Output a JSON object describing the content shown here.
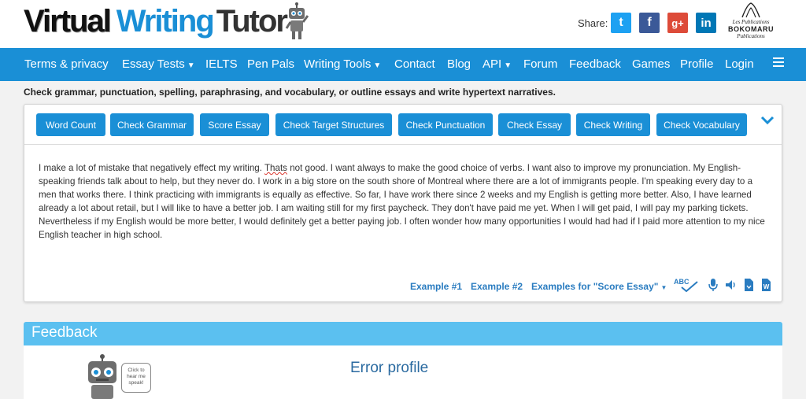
{
  "header": {
    "logo": {
      "part1": "Virtual",
      "part2": "Writing",
      "part3": "Tutor"
    },
    "share_label": "Share:",
    "social": [
      {
        "name": "twitter",
        "glyph": "t",
        "color": "#1da1f2"
      },
      {
        "name": "facebook",
        "glyph": "f",
        "color": "#3b5998"
      },
      {
        "name": "google-plus",
        "glyph": "g+",
        "color": "#dd4b39"
      },
      {
        "name": "linkedin",
        "glyph": "in",
        "color": "#0077b5"
      }
    ],
    "publisher": {
      "line1": "Les Publications",
      "line2": "BOKOMARU",
      "line3": "Publications"
    }
  },
  "nav": {
    "items": [
      {
        "label": "Terms & privacy",
        "dropdown": false
      },
      {
        "label": "Essay Tests",
        "dropdown": true
      },
      {
        "label": "IELTS",
        "dropdown": false
      },
      {
        "label": "Pen Pals",
        "dropdown": false
      },
      {
        "label": "Writing Tools",
        "dropdown": true
      },
      {
        "label": "Contact",
        "dropdown": false
      },
      {
        "label": "Blog",
        "dropdown": false
      },
      {
        "label": "API",
        "dropdown": true
      },
      {
        "label": "Forum",
        "dropdown": false
      },
      {
        "label": "Feedback",
        "dropdown": false
      },
      {
        "label": "Games",
        "dropdown": false
      },
      {
        "label": "Profile",
        "dropdown": false
      },
      {
        "label": "Login",
        "dropdown": false
      }
    ],
    "menu_icon": "hamburger-icon"
  },
  "tagline": "Check grammar, punctuation, spelling, paraphrasing, and vocabulary, or outline essays and write hypertext narratives.",
  "toolbar": {
    "buttons": [
      "Word Count",
      "Check Grammar",
      "Score Essay",
      "Check Target Structures",
      "Check Punctuation",
      "Check Essay",
      "Check Writing",
      "Check Vocabulary"
    ],
    "expand_icon": "chevron-down-icon"
  },
  "essay": {
    "before": "I make a lot of mistake that negatively effect my writing. ",
    "flagged": "Thats",
    "after": " not good. I want always to make the good choice of verbs. I want also to improve my pronunciation. My English-speaking friends talk about to help, but they never do. I work in a big store on the south shore of Montreal where there are a lot of immigrants people. I'm speaking every day to a men that works there. I think practicing with immigrants is equally as effective. So far, I have work there since 2 weeks and my English is getting more better. Also, I have learned already a lot about retail, but I will like to have a better job. I am waiting still for my first paycheck. They don't have paid me yet. When I will get paid, I will pay my parking tickets. Nevertheless if my English would be more better, I would definitely get a better paying job. I often wonder how many opportunities I would had had if I paid more attention to my nice English teacher in high school."
  },
  "examples": {
    "ex1": "Example #1",
    "ex2": "Example #2",
    "ex3": "Examples for \"Score Essay\"",
    "spell_label": "ABC"
  },
  "tools": [
    "spellcheck-icon",
    "microphone-icon",
    "speaker-icon",
    "download-doc-icon",
    "word-doc-icon"
  ],
  "feedback": {
    "title": "Feedback",
    "bubble": "Click to hear me speak!",
    "heading": "Error profile"
  },
  "colors": {
    "brand_blue": "#1a8fd6",
    "feedback_blue": "#5bc0f0",
    "link_blue": "#2a7cc0"
  }
}
